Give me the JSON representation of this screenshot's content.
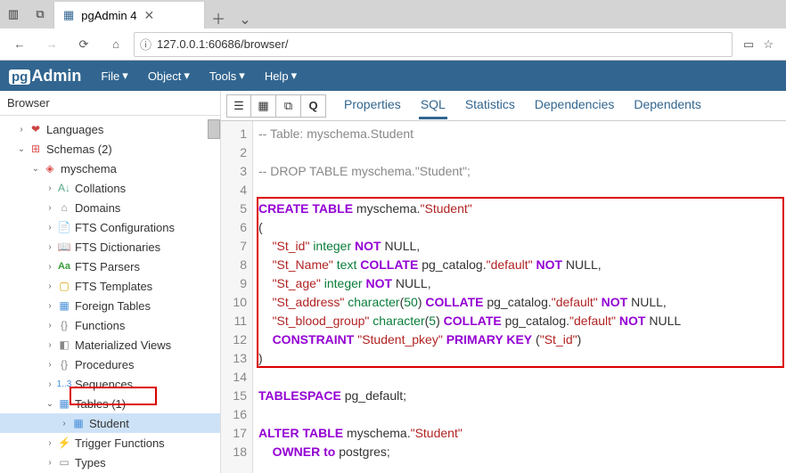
{
  "browser": {
    "tab_title": "pgAdmin 4",
    "url": "127.0.0.1:60686/browser/"
  },
  "menus": {
    "file": "File",
    "object": "Object",
    "tools": "Tools",
    "help": "Help"
  },
  "sidebar": {
    "title": "Browser",
    "items": {
      "languages": "Languages",
      "schemas": "Schemas (2)",
      "myschema": "myschema",
      "collations": "Collations",
      "domains": "Domains",
      "fts_conf": "FTS Configurations",
      "fts_dict": "FTS Dictionaries",
      "fts_pars": "FTS Parsers",
      "fts_tmpl": "FTS Templates",
      "foreign_tables": "Foreign Tables",
      "functions": "Functions",
      "mat_views": "Materialized Views",
      "procedures": "Procedures",
      "sequences": "Sequences",
      "tables": "Tables (1)",
      "student": "Student",
      "trigger_fn": "Trigger Functions",
      "types": "Types"
    }
  },
  "tabs": {
    "properties": "Properties",
    "sql": "SQL",
    "statistics": "Statistics",
    "dependencies": "Dependencies",
    "dependents": "Dependents"
  },
  "code": {
    "line_count": 18,
    "l1_a": "-- Table: myschema.Student",
    "l3_a": "-- DROP TABLE myschema.\"Student\";",
    "l5_kw": "CREATE TABLE",
    "l5_rest": " myschema.",
    "l5_str": "\"Student\"",
    "l6": "(",
    "l7_s1": "    ",
    "l7_str": "\"St_id\"",
    "l7_sp": " ",
    "l7_ty": "integer",
    "l7_sp2": " ",
    "l7_kw": "NOT",
    "l7_r": " NULL,",
    "l8_s1": "    ",
    "l8_str": "\"St_Name\"",
    "l8_sp": " ",
    "l8_ty": "text",
    "l8_sp2": " ",
    "l8_kw1": "COLLATE",
    "l8_mid": " pg_catalog.",
    "l8_str2": "\"default\"",
    "l8_sp3": " ",
    "l8_kw2": "NOT",
    "l8_r": " NULL,",
    "l9_s1": "    ",
    "l9_str": "\"St_age\"",
    "l9_sp": " ",
    "l9_ty": "integer",
    "l9_sp2": " ",
    "l9_kw": "NOT",
    "l9_r": " NULL,",
    "l10_s1": "    ",
    "l10_str": "\"St_address\"",
    "l10_sp": " ",
    "l10_ty": "character",
    "l10_p": "(",
    "l10_num": "50",
    "l10_p2": ") ",
    "l10_kw1": "COLLATE",
    "l10_mid": " pg_catalog.",
    "l10_str2": "\"default\"",
    "l10_sp3": " ",
    "l10_kw2": "NOT",
    "l10_r": " NULL,",
    "l11_s1": "    ",
    "l11_str": "\"St_blood_group\"",
    "l11_sp": " ",
    "l11_ty": "character",
    "l11_p": "(",
    "l11_num": "5",
    "l11_p2": ") ",
    "l11_kw1": "COLLATE",
    "l11_mid": " pg_catalog.",
    "l11_str2": "\"default\"",
    "l11_sp3": " ",
    "l11_kw2": "NOT",
    "l11_r": " NULL",
    "l12_s1": "    ",
    "l12_kw1": "CONSTRAINT",
    "l12_sp": " ",
    "l12_str": "\"Student_pkey\"",
    "l12_sp2": " ",
    "l12_kw2": "PRIMARY KEY",
    "l12_r": " (",
    "l12_str2": "\"St_id\"",
    "l12_r2": ")",
    "l13": ")",
    "l15_kw": "TABLESPACE",
    "l15_r": " pg_default;",
    "l17_kw": "ALTER TABLE",
    "l17_r": " myschema.",
    "l17_str": "\"Student\"",
    "l18_s1": "    ",
    "l18_kw": "OWNER to",
    "l18_r": " postgres;"
  }
}
